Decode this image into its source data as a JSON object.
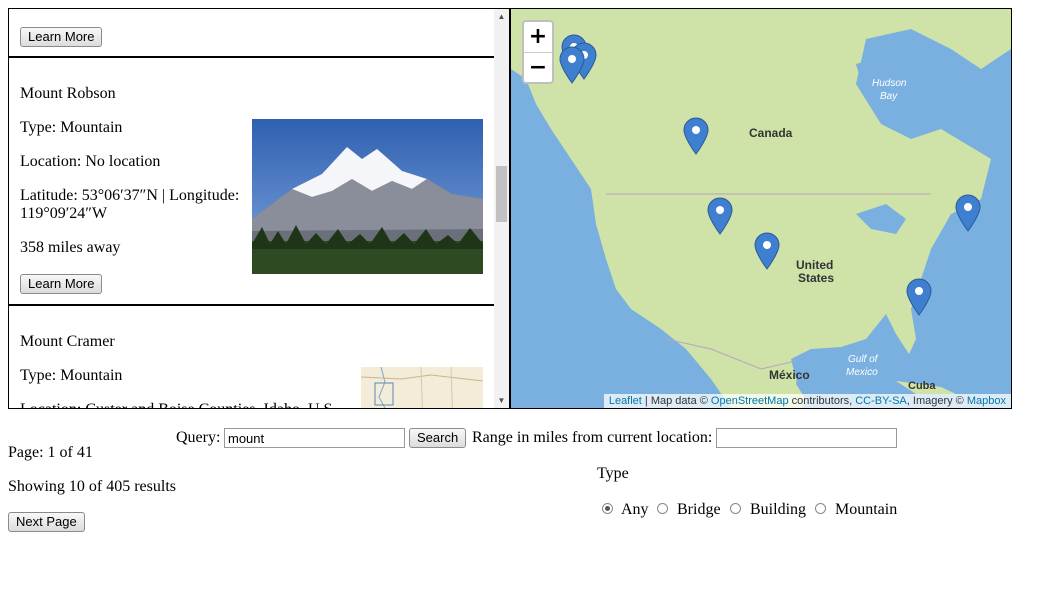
{
  "results": [
    {
      "learn_more": "Learn More"
    },
    {
      "name": "Mount Robson",
      "type": "Type: Mountain",
      "location": "Location: No location",
      "latlon": "Latitude: 53°06′37″N | Longitude: 119°09′24″W",
      "distance": "358 miles away",
      "learn_more": "Learn More",
      "image": "mountain-photo"
    },
    {
      "name": "Mount Cramer",
      "type": "Type: Mountain",
      "location": "Location: Custer and Boise Counties, Idaho, U.S.",
      "image": "map-thumbnail"
    }
  ],
  "map": {
    "zoom_in": "+",
    "zoom_out": "−",
    "labels": {
      "canada": "Canada",
      "united_states_1": "United",
      "united_states_2": "States",
      "mexico": "México",
      "cuba": "Cuba",
      "hudson_1": "Hudson",
      "hudson_2": "Bay",
      "gulf_1": "Gulf of",
      "gulf_2": "Mexico"
    },
    "attribution": {
      "leaflet": "Leaflet",
      "sep1": " | Map data © ",
      "osm": "OpenStreetMap",
      "contrib": " contributors, ",
      "license": "CC-BY-SA",
      "imagery": ", Imagery © ",
      "mapbox": "Mapbox"
    },
    "land_color": "#cfe3a8",
    "water_color": "#7ab0e0",
    "marker_color": "#3f7fcf"
  },
  "pagination": {
    "page": "Page: 1 of 41",
    "showing": "Showing 10 of 405 results",
    "next": "Next Page"
  },
  "search": {
    "query_label": "Query:",
    "query_value": "mount",
    "search_button": "Search",
    "range_label": "Range in miles from current location:",
    "range_value": ""
  },
  "type_filter": {
    "label": "Type",
    "options": [
      "Any",
      "Bridge",
      "Building",
      "Mountain"
    ],
    "selected": "Any"
  }
}
